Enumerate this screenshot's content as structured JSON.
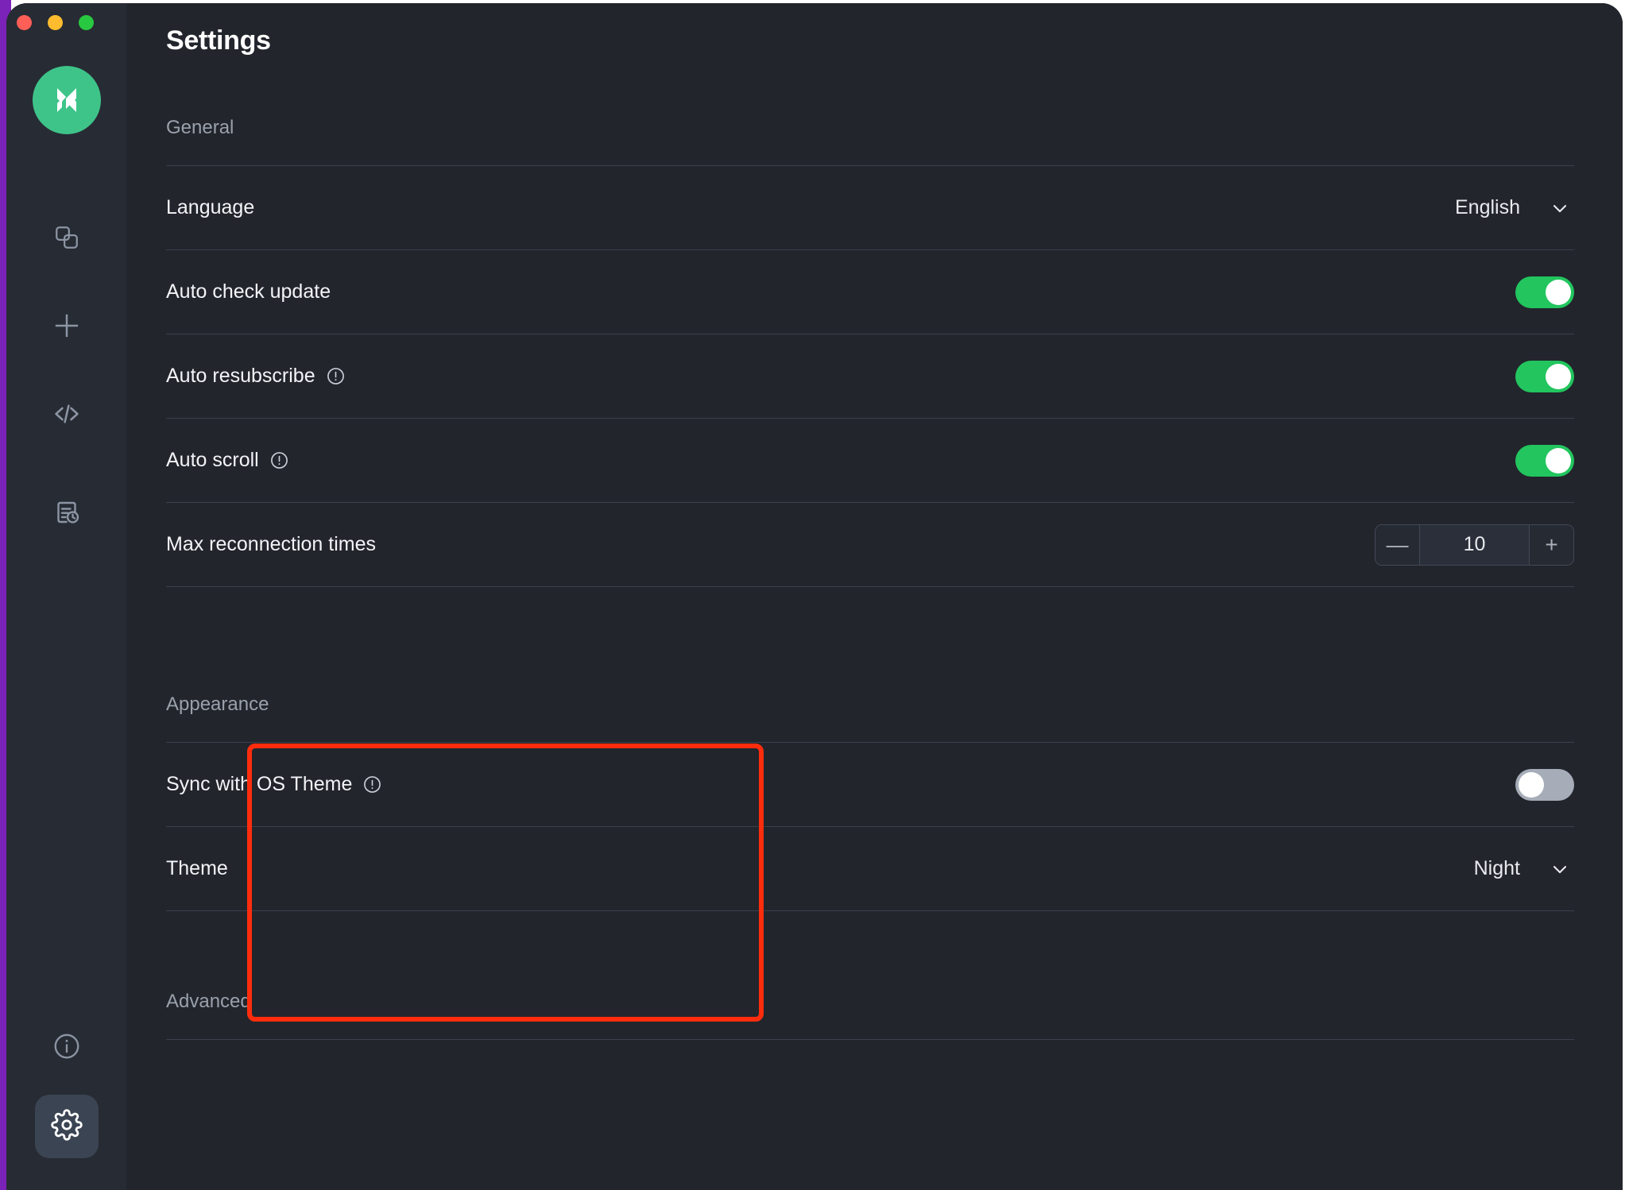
{
  "window": {
    "title": "Settings",
    "traffic_lights": [
      {
        "name": "close",
        "color": "#ff5f57"
      },
      {
        "name": "minimize",
        "color": "#febc2e"
      },
      {
        "name": "maximize",
        "color": "#28c840"
      }
    ],
    "accent_green": "#22c55e",
    "annotation_color": "#ff2d0d"
  },
  "sidebar": {
    "logo_name": "app-logo",
    "items": [
      {
        "name": "proxies",
        "icon": "overlapping-squares-icon",
        "active": false
      },
      {
        "name": "add",
        "icon": "plus-icon",
        "active": false
      },
      {
        "name": "scripts",
        "icon": "code-brackets-icon",
        "active": false
      },
      {
        "name": "logs",
        "icon": "document-clock-icon",
        "active": false
      }
    ],
    "bottom_items": [
      {
        "name": "about",
        "icon": "info-circle-icon",
        "active": false
      },
      {
        "name": "settings",
        "icon": "gear-icon",
        "active": true
      }
    ]
  },
  "sections": {
    "general": {
      "label": "General",
      "rows": {
        "language": {
          "label": "Language",
          "value": "English",
          "control": "dropdown"
        },
        "auto_check_update": {
          "label": "Auto check update",
          "control": "toggle",
          "state": "on"
        },
        "auto_resubscribe": {
          "label": "Auto resubscribe",
          "control": "toggle",
          "state": "on",
          "has_info": true
        },
        "auto_scroll": {
          "label": "Auto scroll",
          "control": "toggle",
          "state": "on",
          "has_info": true
        },
        "max_reconnection_times": {
          "label": "Max reconnection times",
          "control": "stepper",
          "value": "10",
          "minus_label": "—",
          "plus_label": "+"
        }
      }
    },
    "appearance": {
      "label": "Appearance",
      "rows": {
        "sync_os_theme": {
          "label": "Sync with OS Theme",
          "control": "toggle",
          "state": "off",
          "has_info": true
        },
        "theme": {
          "label": "Theme",
          "value": "Night",
          "control": "dropdown"
        }
      }
    },
    "advanced": {
      "label": "Advanced"
    }
  }
}
